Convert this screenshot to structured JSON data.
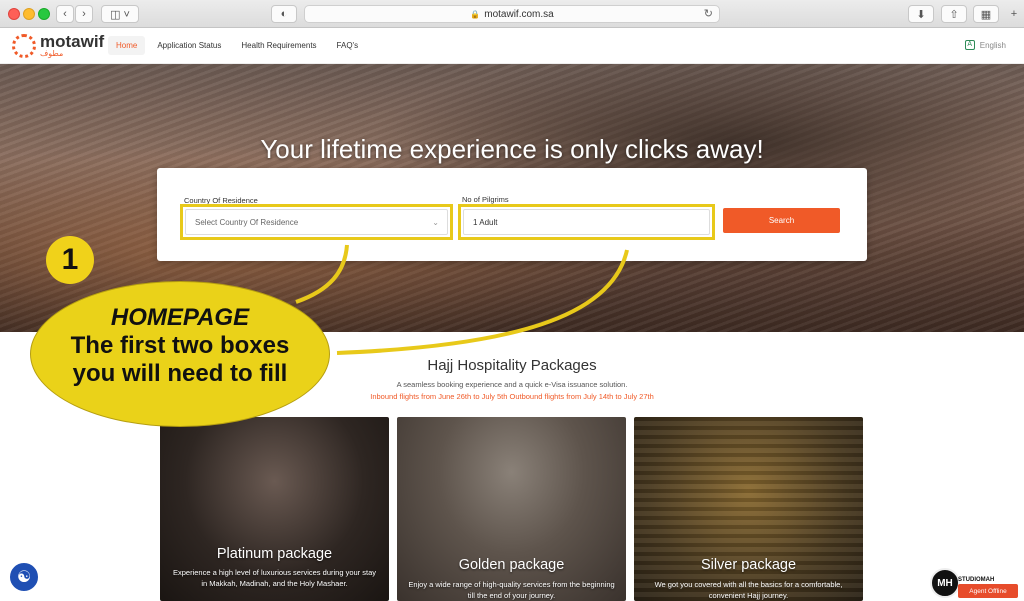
{
  "browser": {
    "url": "motawif.com.sa"
  },
  "nav": {
    "brand": "motawif",
    "brand_arabic": "مطوف",
    "items": [
      {
        "label": "Home",
        "active": true
      },
      {
        "label": "Application Status",
        "active": false
      },
      {
        "label": "Health Requirements",
        "active": false
      },
      {
        "label": "FAQ's",
        "active": false
      }
    ],
    "language": "English"
  },
  "hero": {
    "title": "Your lifetime experience is only clicks away!",
    "country_label": "Country Of Residence",
    "country_placeholder": "Select Country Of Residence",
    "pilgrims_label": "No of Pilgrims",
    "pilgrims_value": "1 Adult",
    "search_label": "Search"
  },
  "annotation": {
    "number": "1",
    "line1": "HOMEPAGE",
    "line2": "The first two boxes",
    "line3": "you will need to fill"
  },
  "section": {
    "title": "Hajj Hospitality Packages",
    "subtitle": "A seamless booking experience and a quick e-Visa issuance solution.",
    "note": "Inbound flights from June 26th to July 5th Outbound flights from July 14th to July 27th"
  },
  "packages": [
    {
      "title": "Platinum package",
      "desc": "Experience a high level of luxurious services during your stay in Makkah, Madinah, and the Holy Mashaer."
    },
    {
      "title": "Golden package",
      "desc": "Enjoy a wide range of high-quality services from the beginning till the end of your journey."
    },
    {
      "title": "Silver package",
      "desc": "We got you covered with all the basics for a comfortable, convenient Hajj journey."
    }
  ],
  "widgets": {
    "studio_mark": "MH",
    "studio_name": "STUDIOMAH",
    "agent_status": "Agent Offline"
  },
  "colors": {
    "accent": "#f05a28",
    "highlight": "#e8c91a"
  }
}
